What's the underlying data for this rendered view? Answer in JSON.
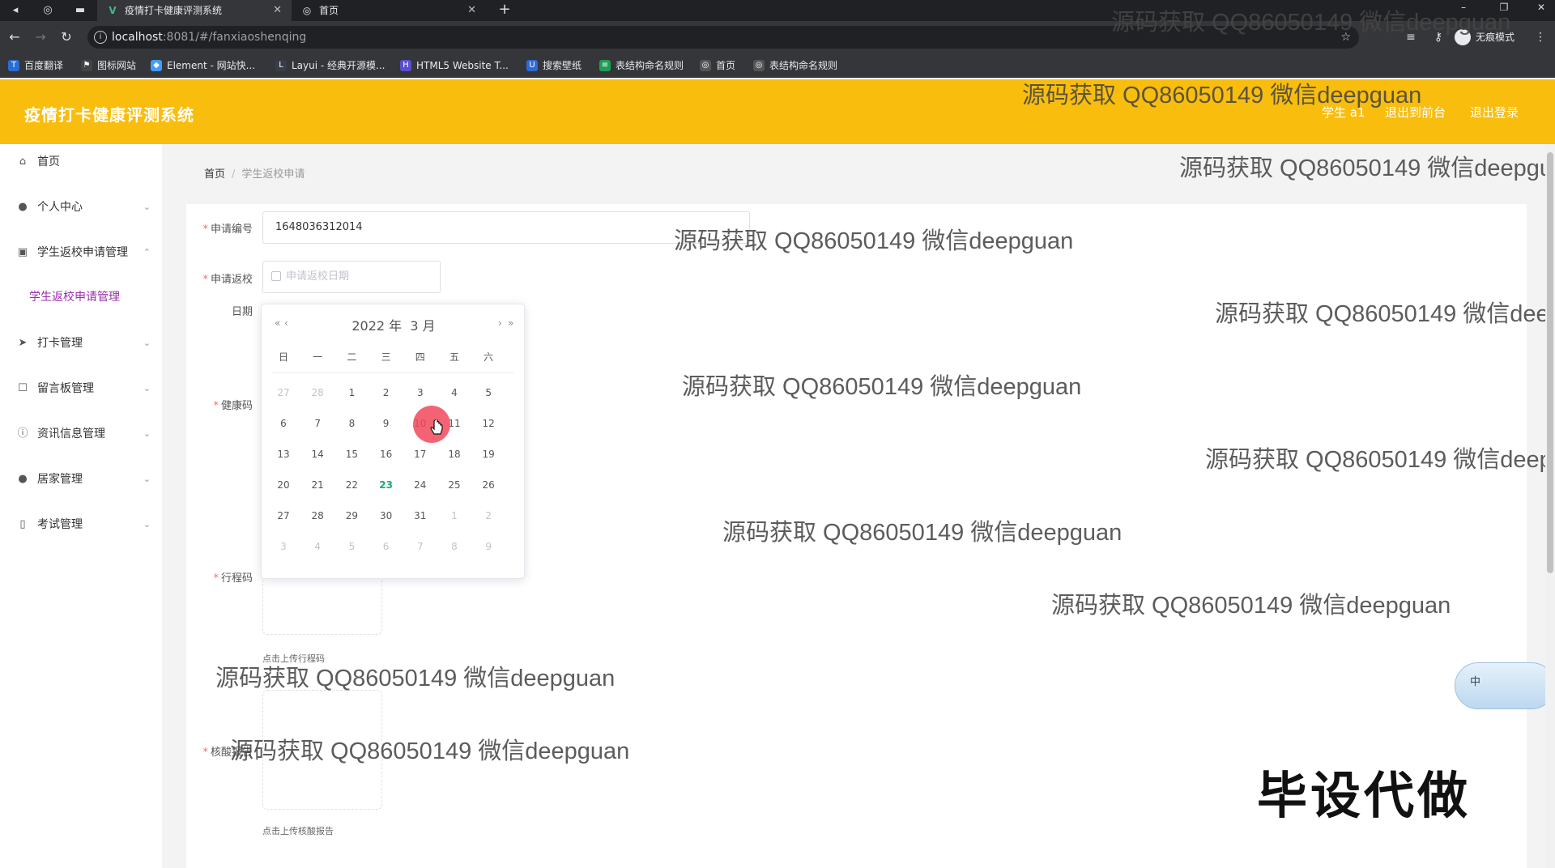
{
  "browser": {
    "tabs": [
      {
        "label": "疫情打卡健康评测系统",
        "active": true,
        "favicon": "vue-icon"
      },
      {
        "label": "首页",
        "active": false,
        "favicon": "globe-icon"
      }
    ],
    "url_host": "localhost",
    "url_path": ":8081/#/fanxiaoshenqing",
    "incognito_label": "无痕模式",
    "bookmarks": [
      "百度翻译",
      "图标网站",
      "Element - 网站快...",
      "Layui - 经典开源模...",
      "HTML5 Website T...",
      "搜索壁纸",
      "表结构命名规则",
      "首页",
      "表结构命名规则"
    ]
  },
  "header": {
    "title": "疫情打卡健康评测系统",
    "user": "学生 a1",
    "to_front": "退出到前台",
    "logout": "退出登录",
    "background": "#f9bd0e"
  },
  "sidebar": {
    "items": [
      {
        "label": "首页",
        "icon": "home-icon"
      },
      {
        "label": "个人中心",
        "icon": "user-icon"
      },
      {
        "label": "学生返校申请管理",
        "icon": "clipboard-icon"
      },
      {
        "label": "打卡管理",
        "icon": "send-icon"
      },
      {
        "label": "留言板管理",
        "icon": "message-icon"
      },
      {
        "label": "资讯信息管理",
        "icon": "info-icon"
      },
      {
        "label": "居家管理",
        "icon": "user-icon"
      },
      {
        "label": "考试管理",
        "icon": "mobile-icon"
      }
    ],
    "active_sub": "学生返校申请管理",
    "active_color": "#9b2fae"
  },
  "breadcrumb": {
    "home": "首页",
    "current": "学生返校申请"
  },
  "form": {
    "apply_no_label": "申请编号",
    "apply_no_value": "1648036312014",
    "return_date_label_1": "申请返校",
    "return_date_label_2": "日期",
    "return_date_placeholder": "申请返校日期",
    "health_code_label": "健康码",
    "trip_code_label": "行程码",
    "trip_code_tip": "点击上传行程码",
    "nat_label": "核酸报告",
    "nat_tip": "点击上传核酸报告"
  },
  "datepicker": {
    "year": "2022 年",
    "month": "3 月",
    "prev_year": "«",
    "prev_month": "‹",
    "next_month": "›",
    "next_year": "»",
    "weekdays": [
      "日",
      "一",
      "二",
      "三",
      "四",
      "五",
      "六"
    ],
    "weeks": [
      [
        "27",
        "28",
        "1",
        "2",
        "3",
        "4",
        "5"
      ],
      [
        "6",
        "7",
        "8",
        "9",
        "10",
        "11",
        "12"
      ],
      [
        "13",
        "14",
        "15",
        "16",
        "17",
        "18",
        "19"
      ],
      [
        "20",
        "21",
        "22",
        "23",
        "24",
        "25",
        "26"
      ],
      [
        "27",
        "28",
        "29",
        "30",
        "31",
        "1",
        "2"
      ],
      [
        "3",
        "4",
        "5",
        "6",
        "7",
        "8",
        "9"
      ]
    ],
    "today": "23",
    "today_color": "#1aa87a"
  },
  "watermark": "源码获取 QQ86050149 微信deepguan",
  "stamp": "毕设代做",
  "ime_label": "中"
}
